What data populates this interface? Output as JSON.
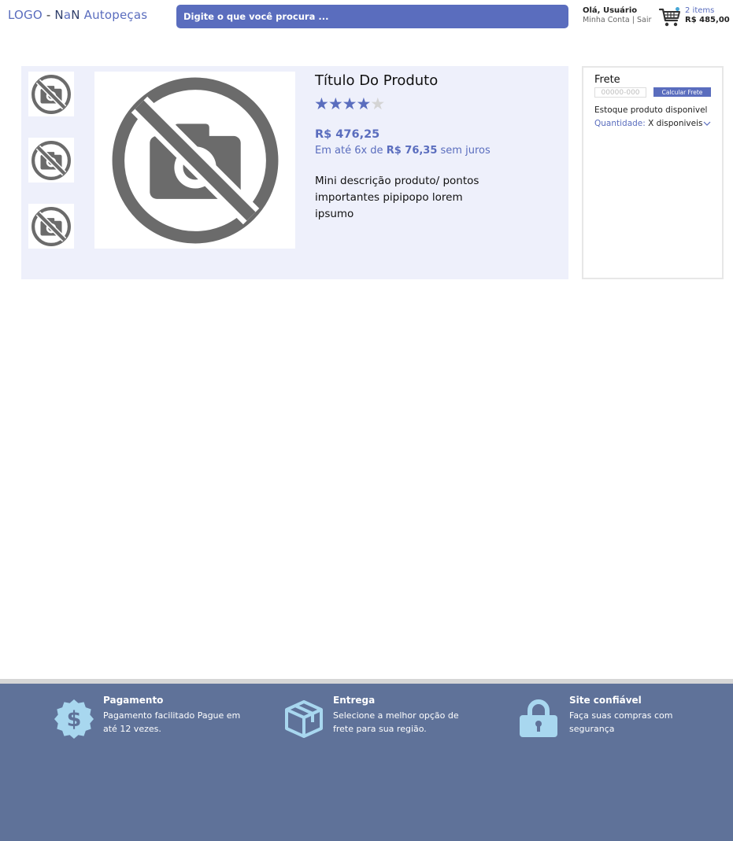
{
  "header": {
    "logo_part1": "LOGO",
    "logo_sep": " - ",
    "logo_n1": "N",
    "logo_a": "a",
    "logo_n2": "N",
    "logo_part3": " Autopeças",
    "search_placeholder": "Digite o que você procura ...",
    "user_greeting": "Olá, Usuário",
    "account_link": "Minha Conta",
    "account_sep": " | ",
    "logout_link": "Sair",
    "cart_icon": "shopping-cart-icon",
    "cart_count": "2 items",
    "cart_total": "R$ 485,00"
  },
  "product": {
    "thumbnail_icon": "no-photo-icon",
    "title": "Título Do Produto",
    "rating": 4,
    "rating_max": 5,
    "price": "R$ 476,25",
    "installment_prefix": "Em até 6x de ",
    "installment_value": "R$ 76,35",
    "installment_suffix": " sem juros",
    "description": "Mini descrição produto/ pontos importantes pipipopo lorem ipsumo"
  },
  "shipping": {
    "title": "Frete",
    "cep_placeholder": "00000-000",
    "calc_button": "Calcular Frete",
    "stock_text": "Estoque produto disponivel",
    "qty_label": "Quantidade: ",
    "qty_value": "X disponiveis"
  },
  "footer": {
    "features": [
      {
        "icon": "dollar-badge-icon",
        "title": "Pagamento",
        "text": "Pagamento facilitado Pague em até 12 vezes."
      },
      {
        "icon": "package-box-icon",
        "title": "Entrega",
        "text": "Selecione a melhor opção de frete para sua região."
      },
      {
        "icon": "padlock-icon",
        "title": "Site confiável",
        "text": "Faça suas compras com segurança"
      }
    ]
  },
  "colors": {
    "accent": "#5A6DBE",
    "panel_bg": "#EEF0FB",
    "footer_bg": "#5F7299",
    "footer_icon": "#A8D7EF"
  }
}
